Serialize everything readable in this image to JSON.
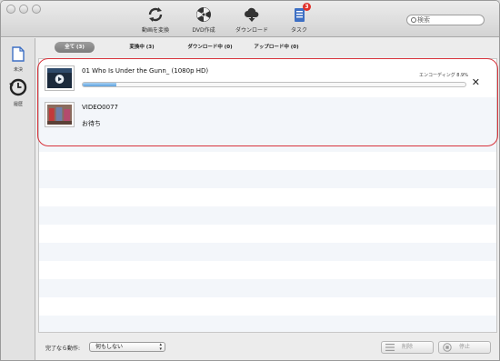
{
  "toolbar": {
    "convert": "動画を変換",
    "dvd": "DVD作成",
    "download": "ダウンロード",
    "task": "タスク",
    "task_badge": "3"
  },
  "search": {
    "placeholder": "検索"
  },
  "sidebar": {
    "items": [
      {
        "label": "未決",
        "icon": "document-icon"
      },
      {
        "label": "履歴",
        "icon": "history-clock-icon"
      }
    ]
  },
  "tabs": [
    {
      "label": "全て (3)",
      "active": true
    },
    {
      "label": "変換中 (3)"
    },
    {
      "label": "ダウンロード中 (0)"
    },
    {
      "label": "アップロード中 (0)"
    }
  ],
  "tasks": [
    {
      "title": "01 Who Is Under the Gunn_ (1080p HD)",
      "status": "エンコーディング 8.9%",
      "progress": 0.089
    },
    {
      "title": "VIDEO0077",
      "status": "お待ち"
    }
  ],
  "footer": {
    "after_label": "完了なら動作:",
    "after_value": "何もしない",
    "delete": "削除",
    "stop": "停止"
  },
  "colors": {
    "accent": "#3d6fc4",
    "badge": "#e0302a",
    "highlight": "#d8343c"
  }
}
